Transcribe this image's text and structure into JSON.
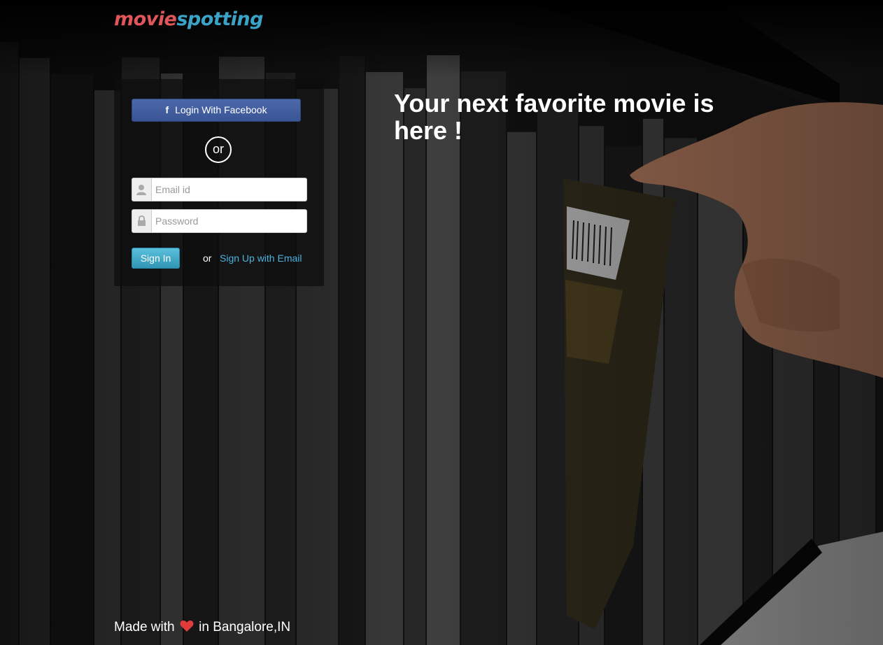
{
  "brand": {
    "part1": "movie",
    "part2": "spotting",
    "color1": "#e0565b",
    "color2": "#3aa3c7"
  },
  "login": {
    "facebook_icon": "facebook-f-icon",
    "facebook_label": "Login With Facebook",
    "or_divider": "or",
    "email": {
      "placeholder": "Email id",
      "value": "",
      "icon": "user-icon"
    },
    "password": {
      "placeholder": "Password",
      "value": "",
      "icon": "lock-icon"
    },
    "signin_label": "Sign In",
    "or_text": "or",
    "signup_label": "Sign Up with Email"
  },
  "hero": {
    "headline": "Your next favorite movie is here !"
  },
  "footer": {
    "made_with": "Made with",
    "heart_icon": "heart-icon",
    "location": "in Bangalore,IN"
  },
  "colors": {
    "facebook": "#3b5998",
    "signin": "#3fa9c8",
    "link": "#4bb3de",
    "heart": "#e03c3c"
  }
}
